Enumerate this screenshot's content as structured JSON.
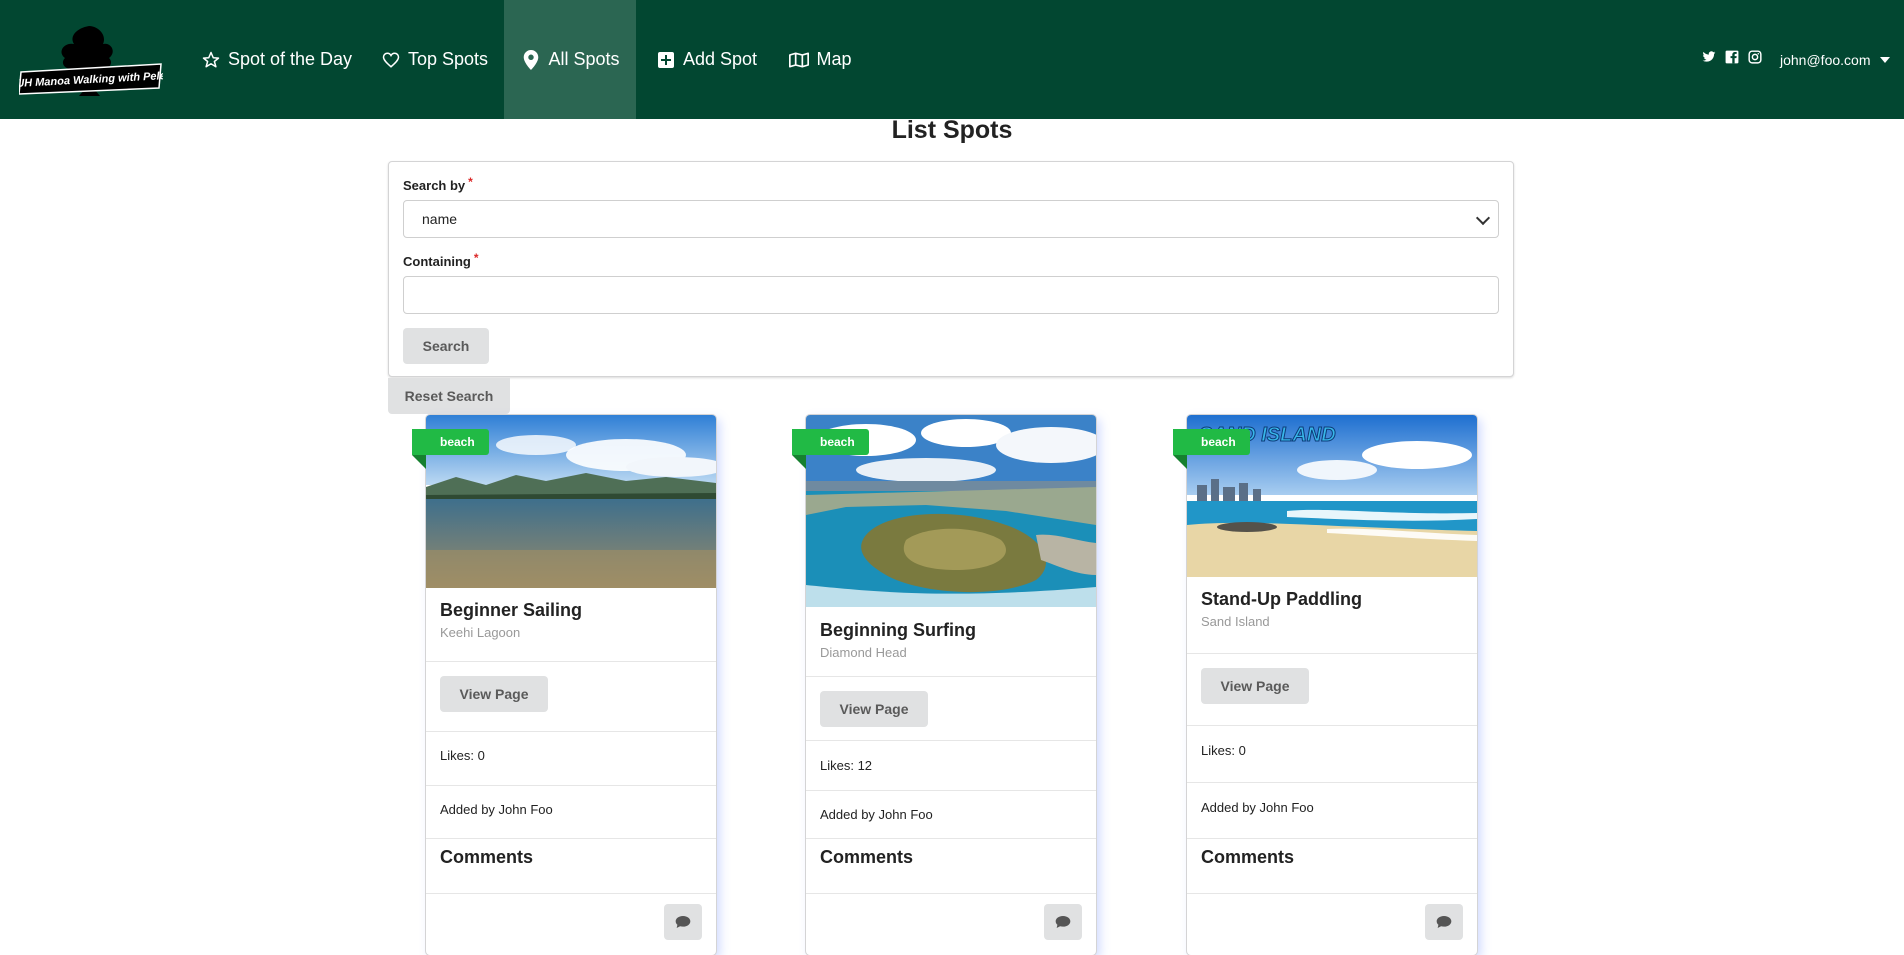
{
  "nav": {
    "logo_text": "UH Manoa Walking with Pele",
    "items": [
      {
        "label": "Spot of the Day",
        "icon": "star-outline-icon"
      },
      {
        "label": "Top Spots",
        "icon": "heart-outline-icon"
      },
      {
        "label": "All Spots",
        "icon": "map-marker-icon",
        "active": true
      },
      {
        "label": "Add Spot",
        "icon": "plus-square-icon"
      },
      {
        "label": "Map",
        "icon": "map-outline-icon"
      }
    ],
    "social": [
      "twitter-icon",
      "facebook-icon",
      "instagram-icon"
    ],
    "user": "john@foo.com"
  },
  "page": {
    "title": "List Spots"
  },
  "search": {
    "search_by_label": "Search by",
    "search_by_value": "name",
    "containing_label": "Containing",
    "containing_value": "",
    "required_mark": "*",
    "search_button": "Search",
    "reset_button": "Reset Search"
  },
  "cards": [
    {
      "tag": "beach",
      "title": "Beginner Sailing",
      "location": "Keehi Lagoon",
      "view_label": "View Page",
      "likes": "Likes: 0",
      "added_by": "Added by John Foo",
      "comments_heading": "Comments"
    },
    {
      "tag": "beach",
      "title": "Beginning Surfing",
      "location": "Diamond Head",
      "view_label": "View Page",
      "likes": "Likes: 12",
      "added_by": "Added by John Foo",
      "comments_heading": "Comments"
    },
    {
      "tag": "beach",
      "title": "Stand-Up Paddling",
      "location": "Sand Island",
      "image_caption": "SAND ISLAND",
      "view_label": "View Page",
      "likes": "Likes: 0",
      "added_by": "Added by John Foo",
      "comments_heading": "Comments"
    }
  ],
  "colors": {
    "navbar": "#024731",
    "active_nav": "#2b6652",
    "ribbon": "#21ba45",
    "button_gray": "#e0e1e2"
  }
}
